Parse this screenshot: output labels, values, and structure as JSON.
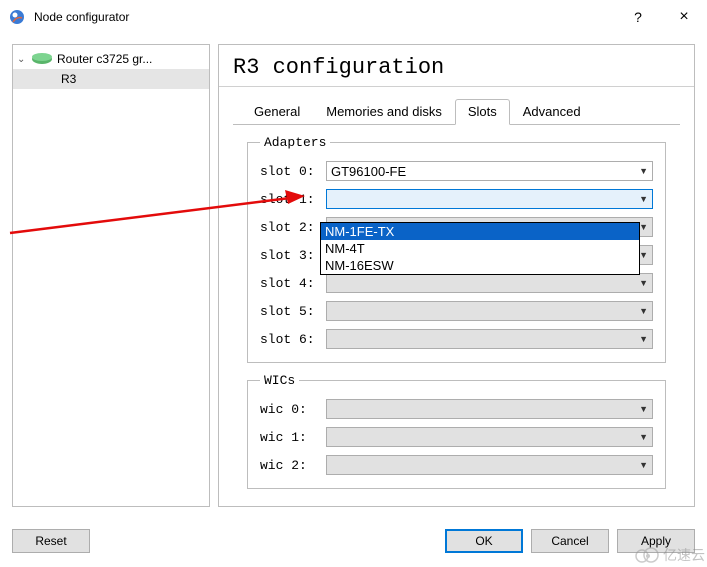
{
  "window": {
    "title": "Node configurator",
    "help": "?",
    "close": "×"
  },
  "tree": {
    "parent": "Router c3725 gr...",
    "child": "R3"
  },
  "panel": {
    "title": "R3 configuration"
  },
  "tabs": {
    "general": "General",
    "memories": "Memories and disks",
    "slots": "Slots",
    "advanced": "Advanced"
  },
  "adapters": {
    "legend": "Adapters",
    "slot0_label": "slot 0:",
    "slot0_value": "GT96100-FE",
    "slot1_label": "slot 1:",
    "slot1_value": "",
    "slot2_label": "slot 2:",
    "slot3_label": "slot 3:",
    "slot4_label": "slot 4:",
    "slot5_label": "slot 5:",
    "slot6_label": "slot 6:",
    "options": {
      "opt1": "NM-1FE-TX",
      "opt2": "NM-4T",
      "opt3": "NM-16ESW"
    }
  },
  "wics": {
    "legend": "WICs",
    "wic0_label": "wic 0:",
    "wic1_label": "wic 1:",
    "wic2_label": "wic 2:"
  },
  "footer": {
    "reset": "Reset",
    "ok": "OK",
    "cancel": "Cancel",
    "apply": "Apply"
  },
  "watermark": "亿速云"
}
